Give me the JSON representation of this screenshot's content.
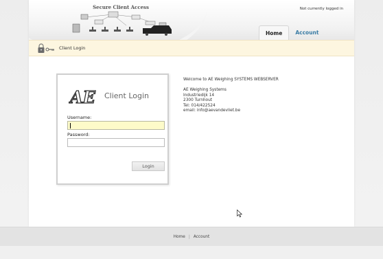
{
  "header": {
    "logo_title": "Secure Client Access",
    "login_status": "Not currently logged in",
    "tabs": [
      {
        "label": "Home",
        "active": true
      },
      {
        "label": "Account",
        "active": false
      }
    ]
  },
  "breadcrumb": {
    "icon": "key-lock-icon",
    "label": "Client Login"
  },
  "login_form": {
    "logo_text": "AE",
    "title": "Client Login",
    "username_label": "Username:",
    "username_value": "",
    "password_label": "Password:",
    "password_value": "",
    "submit_label": "Login"
  },
  "info": {
    "welcome": "Welcome to AE Weighing SYSTEMS WEBSERVER",
    "address_lines": [
      "AE Weighing Systems",
      "Industriedijk 14",
      "2300 Turnhout",
      "Tel: 014/422524",
      "email: info@aevandevliet.be"
    ]
  },
  "footer": {
    "links": [
      "Home",
      "Account"
    ],
    "separator": "|"
  },
  "colors": {
    "accent": "#3a7ca5",
    "breadcrumb_bg": "#fdf6e0",
    "focused_field": "#fdfbc9"
  }
}
